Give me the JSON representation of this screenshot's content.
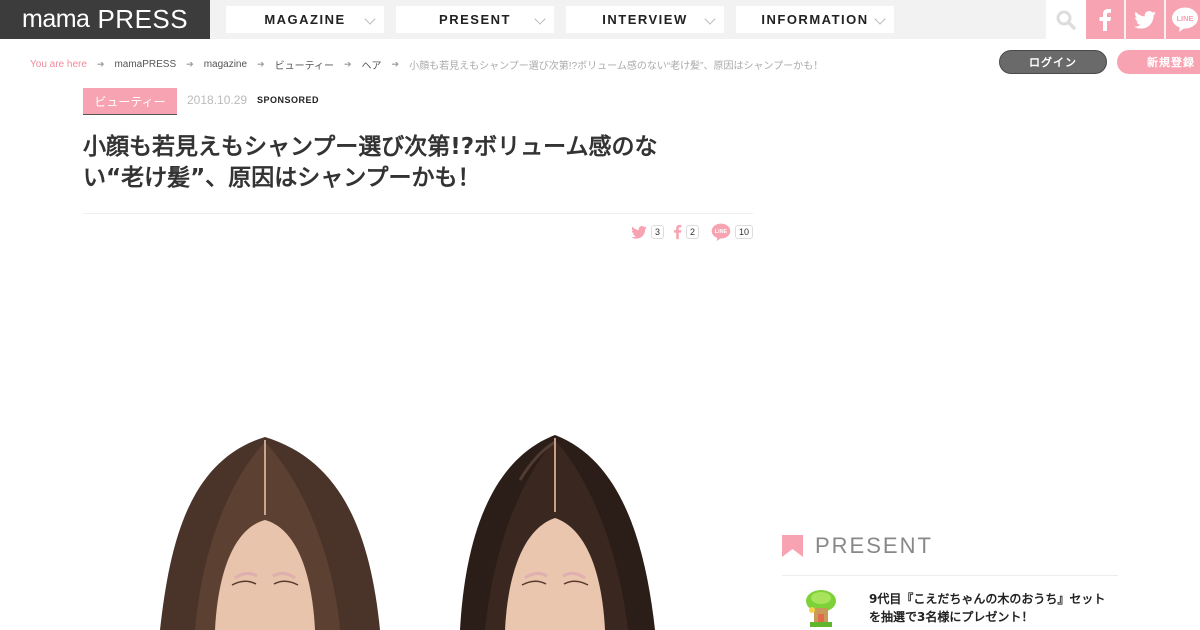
{
  "site": {
    "logo_mama": "mama",
    "logo_press": "PRESS"
  },
  "nav": {
    "tabs": [
      {
        "label": "MAGAZINE"
      },
      {
        "label": "PRESENT"
      },
      {
        "label": "INTERVIEW"
      },
      {
        "label": "INFORMATION"
      }
    ]
  },
  "header_icons": [
    "search-icon",
    "facebook-icon",
    "twitter-icon",
    "line-icon"
  ],
  "breadcrumb": {
    "here": "You are here",
    "items": [
      "mamaPRESS",
      "magazine",
      "ビューティー",
      "ヘア"
    ],
    "current": "小顔も若見えもシャンプー選び次第!?ボリューム感のない“老け髪”、原因はシャンプーかも！"
  },
  "account": {
    "login": "ログイン",
    "register": "新規登録"
  },
  "article": {
    "category": "ビューティー",
    "date": "2018.10.29",
    "sponsored": "SPONSORED",
    "title": "小顔も若見えもシャンプー選び次第!?ボリューム感のない“老け髪”、原因はシャンプーかも！",
    "shares": {
      "twitter": "3",
      "facebook": "2",
      "line": "10"
    }
  },
  "sidebar": {
    "present_heading": "PRESENT",
    "present_item": "9代目『こえだちゃんの木のおうち』セットを抽選で3名様にプレゼント！"
  },
  "colors": {
    "accent_pink": "#f7a3b1",
    "logo_bg": "#3c3c3c",
    "topbar_bg": "#f2f2f2"
  }
}
